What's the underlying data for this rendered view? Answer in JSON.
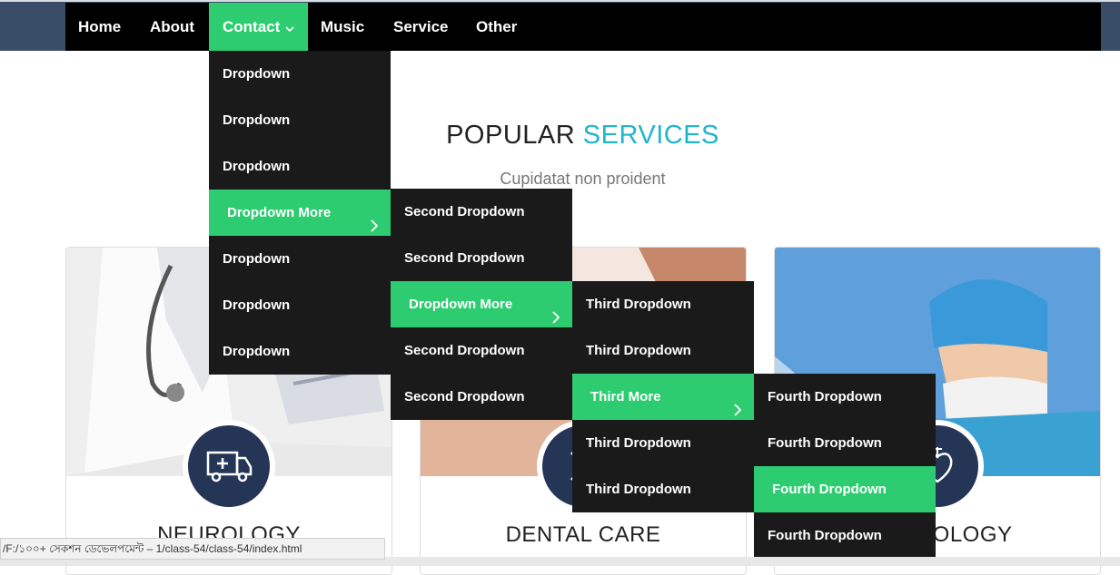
{
  "nav": {
    "items": [
      "Home",
      "About",
      "Contact",
      "Music",
      "Service",
      "Other"
    ],
    "active": "Contact"
  },
  "menu_level1": {
    "items": [
      "Dropdown",
      "Dropdown",
      "Dropdown",
      "Dropdown More",
      "Dropdown",
      "Dropdown",
      "Dropdown"
    ]
  },
  "menu_level2": {
    "items": [
      "Second Dropdown",
      "Second Dropdown",
      "Dropdown More",
      "Second Dropdown",
      "Second Dropdown"
    ]
  },
  "menu_level3": {
    "items": [
      "Third Dropdown",
      "Third Dropdown",
      "Third More",
      "Third Dropdown",
      "Third Dropdown"
    ]
  },
  "menu_level4": {
    "items": [
      "Fourth Dropdown",
      "Fourth Dropdown",
      "Fourth Dropdown",
      "Fourth Dropdown"
    ]
  },
  "section": {
    "title_main": "POPULAR ",
    "title_accent": "SERVICES",
    "subtitle": "Cupidatat non proident"
  },
  "cards": [
    {
      "title": "NEUROLOGY",
      "icon": "ambulance-icon"
    },
    {
      "title": "DENTAL CARE",
      "icon": "dna-icon"
    },
    {
      "title": "CARDIOLOGY",
      "icon": "heart-icon"
    }
  ],
  "status_bar": {
    "url": "/F:/১০০+ সেকশন ডেভেলপমেন্ট – 1/class-54/class-54/index.html"
  },
  "colors": {
    "accent_green": "#2ecc71",
    "accent_teal": "#1fb5cc",
    "navbar": "#000000",
    "dropdown_bg": "#1a1a1a",
    "badge": "#243556"
  }
}
